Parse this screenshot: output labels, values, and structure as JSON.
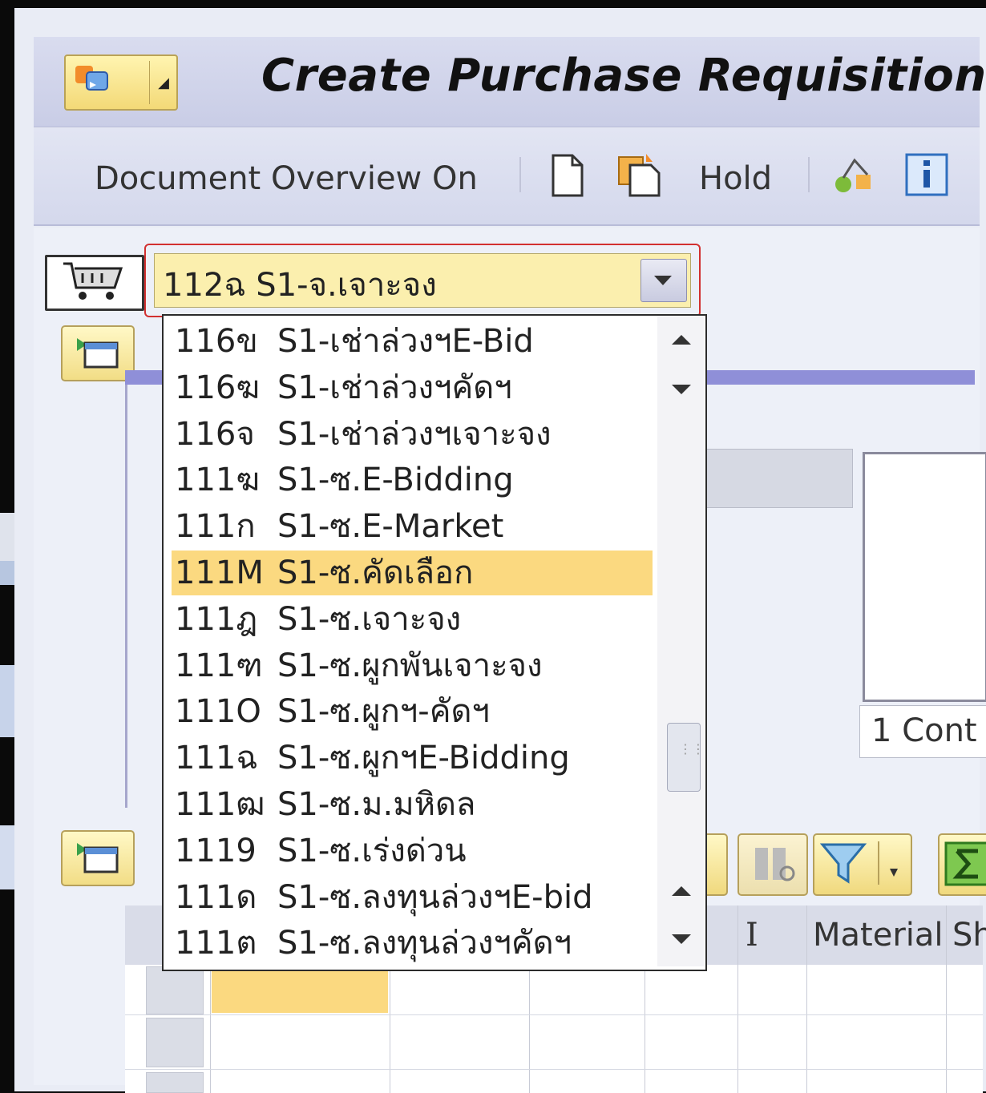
{
  "window": {
    "title": "Create Purchase Requisition"
  },
  "toolbar": {
    "document_overview_label": "Document Overview On",
    "hold_label": "Hold",
    "icons": [
      "new-document-icon",
      "copy-document-icon",
      "hold-label",
      "personal-settings-icon",
      "info-icon"
    ]
  },
  "doc_type": {
    "selected_value": "112ฉ S1-จ.เจาะจง"
  },
  "dropdown": {
    "options": [
      {
        "code": "116ข",
        "label": "S1-เช่าล่วงฯE-Bid"
      },
      {
        "code": "116ฆ",
        "label": "S1-เช่าล่วงฯคัดฯ"
      },
      {
        "code": "116จ",
        "label": "S1-เช่าล่วงฯเจาะจง"
      },
      {
        "code": "111ฆ",
        "label": "S1-ซ.E-Bidding"
      },
      {
        "code": "111ก",
        "label": "S1-ซ.E-Market"
      },
      {
        "code": "111M",
        "label": "S1-ซ.คัดเลือก"
      },
      {
        "code": "111ฎ",
        "label": "S1-ซ.เจาะจง"
      },
      {
        "code": "111ฑ",
        "label": "S1-ซ.ผูกพันเจาะจง"
      },
      {
        "code": "111O",
        "label": "S1-ซ.ผูกฯ-คัดฯ"
      },
      {
        "code": "111ฉ",
        "label": "S1-ซ.ผูกฯE-Bidding"
      },
      {
        "code": "111ฒ",
        "label": "S1-ซ.ม.มหิดล"
      },
      {
        "code": "1119",
        "label": "S1-ซ.เร่งด่วน"
      },
      {
        "code": "111ด",
        "label": "S1-ซ.ลงทุนล่วงฯE-bid"
      },
      {
        "code": "111ต",
        "label": "S1-ซ.ลงทุนล่วงฯคัดฯ"
      }
    ],
    "highlighted_index": 5
  },
  "content": {
    "cont_label": "1 Cont",
    "grid_headers": {
      "col_i": "I",
      "col_material": "Material",
      "col_short": "Sh"
    }
  },
  "colors": {
    "highlight": "#fbd980",
    "field_bg": "#fbefae"
  }
}
